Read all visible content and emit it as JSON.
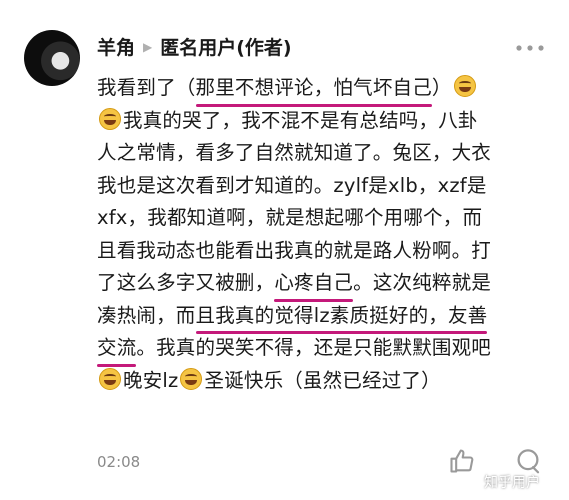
{
  "comment": {
    "author": "羊角",
    "reply_to": "匿名用户(作者)",
    "lines": [
      {
        "segments": [
          {
            "text": "我看到了（"
          },
          {
            "text": "那里不想评论，怕气坏自己",
            "underline": true
          },
          {
            "text": "）"
          }
        ],
        "emoji_end": true
      },
      {
        "emoji_start": true,
        "segments": [
          {
            "text": "我真的哭了，我不混不是有总结吗，八卦"
          }
        ]
      },
      {
        "segments": [
          {
            "text": "人之常情，看多了自然就知道了。兔区，大衣"
          }
        ]
      },
      {
        "segments": [
          {
            "text": "我也是这次看到才知道的。zylf是xlb，xzf是"
          }
        ]
      },
      {
        "segments": [
          {
            "text": "xfx，我都知道啊，就是想起哪个用哪个，而"
          }
        ]
      },
      {
        "segments": [
          {
            "text": "且看我动态也能看出我真的就是路人粉啊。打"
          }
        ]
      },
      {
        "segments": [
          {
            "text": "了这么多字又被删，"
          },
          {
            "text": "心疼自己",
            "underline": true
          },
          {
            "text": "。这次纯粹就是"
          }
        ]
      },
      {
        "segments": [
          {
            "text": "凑热闹，而"
          },
          {
            "text": "且我真的觉得lz素质挺好的，友善",
            "underline": true
          }
        ]
      },
      {
        "segments": [
          {
            "text": "交流",
            "underline": true
          },
          {
            "text": "。我真的哭笑不得，还是只能默默围观吧"
          }
        ]
      },
      {
        "emoji_start": true,
        "segments": [
          {
            "text": "晚安lz"
          }
        ],
        "emoji_mid": true,
        "after_mid": [
          {
            "text": "圣诞快乐（虽然已经过了）"
          }
        ]
      }
    ],
    "time": "02:08"
  },
  "watermark": "知乎用户",
  "icons": {
    "more": "more-icon",
    "like": "thumbs-up-icon",
    "comment": "comment-icon",
    "emoji": "laugh-cry-emoji-icon"
  },
  "colors": {
    "underline": "#c4197a",
    "meta": "#8a8a8a"
  }
}
